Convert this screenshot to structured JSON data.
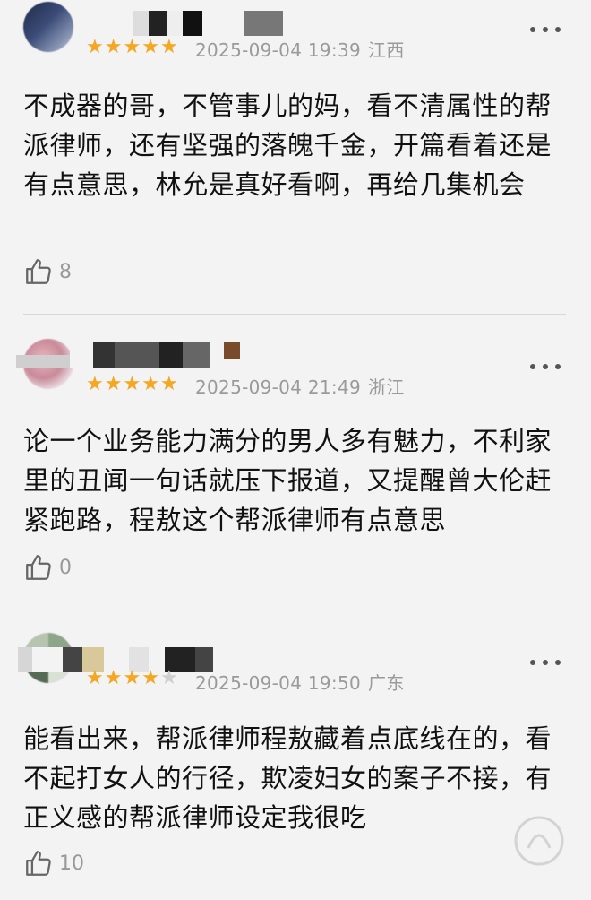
{
  "comments": [
    {
      "stars": 5,
      "star_color": "#f5a623",
      "date": "2025-09-04 19:39",
      "region": "江西",
      "text": "不成器的哥，不管事儿的妈，看不清属性的帮派律师，还有坚强的落魄千金，开篇看着还是有点意思，林允是真好看啊，再给几集机会",
      "likes": "8"
    },
    {
      "stars": 5,
      "star_color": "#f5a623",
      "date": "2025-09-04 21:49",
      "region": "浙江",
      "text": "论一个业务能力满分的男人多有魅力，不利家里的丑闻一句话就压下报道，又提醒曾大伦赶紧跑路，程敖这个帮派律师有点意思",
      "likes": "0"
    },
    {
      "stars": 4,
      "star_color": "#f5a623",
      "date": "2025-09-04 19:50",
      "region": "广东",
      "text": "能看出来，帮派律师程敖藏着点底线在的，看不起打女人的行径，欺凌妇女的案子不接，有正义感的帮派律师设定我很吃",
      "likes": "10"
    }
  ],
  "icons": {
    "like": "thumbs-up-icon",
    "more": "more-dots-icon"
  }
}
